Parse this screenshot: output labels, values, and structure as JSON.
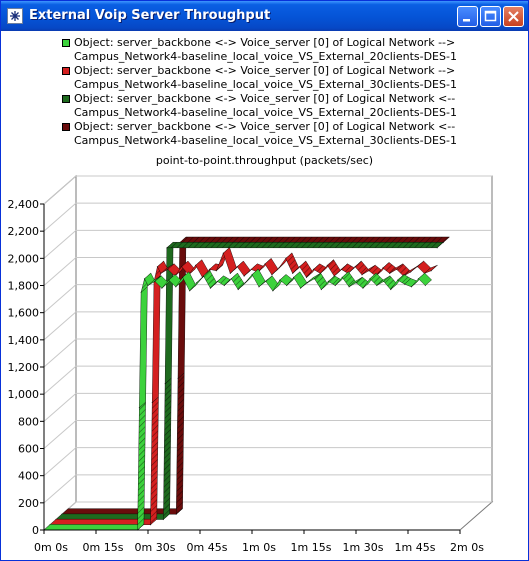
{
  "window": {
    "title": "External Voip Server Throughput"
  },
  "legend": [
    {
      "line1": "Object: server_backbone <-> Voice_server [0] of Logical Network -->",
      "line2": "Campus_Network4-baseline_local_voice_VS_External_20clients-DES-1",
      "color": "#3cd23c"
    },
    {
      "line1": "Object: server_backbone <-> Voice_server [0] of Logical Network -->",
      "line2": "Campus_Network4-baseline_local_voice_VS_External_30clients-DES-1",
      "color": "#d42020"
    },
    {
      "line1": "Object: server_backbone <-> Voice_server [0] of Logical Network <--",
      "line2": "Campus_Network4-baseline_local_voice_VS_External_20clients-DES-1",
      "color": "#1e6a1e"
    },
    {
      "line1": "Object: server_backbone <-> Voice_server [0] of Logical Network <--",
      "line2": "Campus_Network4-baseline_local_voice_VS_External_30clients-DES-1",
      "color": "#6a0c0c"
    }
  ],
  "chart_data": {
    "type": "line",
    "title": "point-to-point.throughput (packets/sec)",
    "style": "3d-ribbon",
    "grid": true,
    "x_ticks": [
      "0m 0s",
      "0m 15s",
      "0m 30s",
      "0m 45s",
      "1m 0s",
      "1m 15s",
      "1m 30s",
      "1m 45s",
      "2m 0s"
    ],
    "xlim": [
      0,
      120
    ],
    "y_ticks": [
      "0",
      "200",
      "400",
      "600",
      "800",
      "1,000",
      "1,200",
      "1,400",
      "1,600",
      "1,800",
      "2,000",
      "2,200",
      "2,400"
    ],
    "ylim": [
      0,
      2400
    ],
    "series": [
      {
        "name": "Object: server_backbone <-> Voice_server [0] of Logical Network --> Campus_Network4-baseline_local_voice_VS_External_20clients-DES-1",
        "color": "#3cd23c",
        "x": [
          0,
          27,
          27.5,
          28,
          29,
          30,
          32,
          34,
          36,
          38,
          40,
          42,
          44,
          46,
          48,
          50,
          52,
          54,
          56,
          58,
          60,
          62,
          64,
          66,
          68,
          70,
          72,
          74,
          76,
          78,
          80,
          82,
          84,
          86,
          88,
          90,
          92,
          94,
          96,
          98,
          100,
          102,
          104,
          106,
          108,
          110
        ],
        "y": [
          0,
          0,
          900,
          1750,
          1850,
          1800,
          1830,
          1780,
          1840,
          1790,
          1860,
          1760,
          1820,
          1870,
          1780,
          1830,
          1800,
          1850,
          1770,
          1820,
          1880,
          1790,
          1830,
          1760,
          1840,
          1800,
          1860,
          1780,
          1820,
          1850,
          1770,
          1830,
          1800,
          1860,
          1790,
          1820,
          1780,
          1850,
          1800,
          1830,
          1770,
          1840,
          1810,
          1790,
          1850,
          1800
        ]
      },
      {
        "name": "Object: server_backbone <-> Voice_server [0] of Logical Network --> Campus_Network4-baseline_local_voice_VS_External_30clients-DES-1",
        "color": "#d42020",
        "x": [
          0,
          29,
          29.5,
          30,
          31,
          32,
          34,
          36,
          38,
          40,
          42,
          44,
          46,
          48,
          50,
          52,
          54,
          56,
          58,
          60,
          62,
          64,
          66,
          68,
          70,
          72,
          74,
          76,
          78,
          80,
          82,
          84,
          86,
          88,
          90,
          92,
          94,
          96,
          98,
          100,
          102,
          104,
          106,
          108,
          110
        ],
        "y": [
          0,
          0,
          900,
          1790,
          1900,
          1850,
          1880,
          1830,
          1900,
          1840,
          1910,
          1820,
          1880,
          1870,
          2000,
          1850,
          1900,
          1830,
          1880,
          1860,
          1920,
          1840,
          1890,
          1960,
          1850,
          1900,
          1820,
          1880,
          1850,
          1910,
          1830,
          1880,
          1850,
          1900,
          1840,
          1870,
          1830,
          1890,
          1850,
          1880,
          1830,
          1860,
          1900,
          1850,
          1870
        ]
      },
      {
        "name": "Object: server_backbone <-> Voice_server [0] of Logical Network <-- Campus_Network4-baseline_local_voice_VS_External_20clients-DES-1",
        "color": "#1e6a1e",
        "x": [
          0,
          31,
          31.5,
          32,
          110
        ],
        "y": [
          0,
          0,
          1000,
          2000,
          2000
        ]
      },
      {
        "name": "Object: server_backbone <-> Voice_server [0] of Logical Network <-- Campus_Network4-baseline_local_voice_VS_External_30clients-DES-1",
        "color": "#6a0c0c",
        "x": [
          0,
          33,
          33.5,
          34,
          110
        ],
        "y": [
          0,
          0,
          1000,
          2000,
          2000
        ]
      }
    ]
  }
}
